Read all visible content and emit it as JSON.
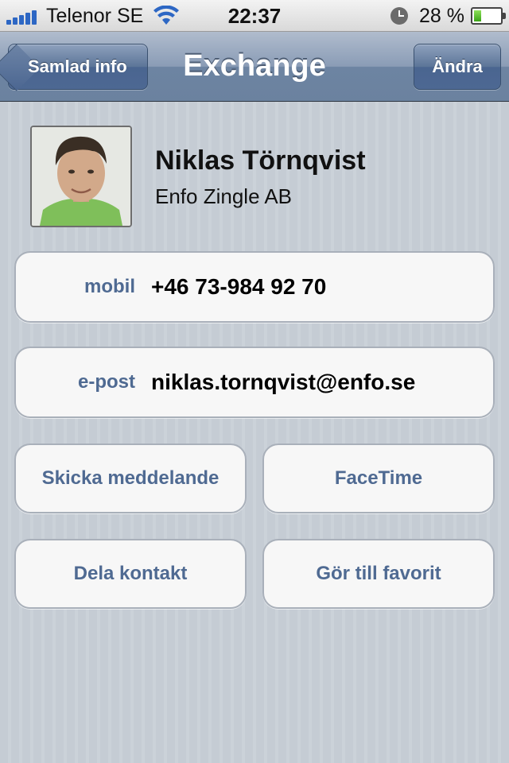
{
  "status_bar": {
    "carrier": "Telenor SE",
    "time": "22:37",
    "battery_percent": "28 %",
    "battery_level": 0.28,
    "signal_bars": 5
  },
  "nav": {
    "back_label": "Samlad info",
    "title": "Exchange",
    "edit_label": "Ändra"
  },
  "contact": {
    "name": "Niklas Törnqvist",
    "company": "Enfo Zingle AB"
  },
  "fields": [
    {
      "label": "mobil",
      "value": "+46 73-984 92 70"
    },
    {
      "label": "e-post",
      "value": "niklas.tornqvist@enfo.se"
    }
  ],
  "actions": {
    "send_message": "Skicka meddelande",
    "facetime": "FaceTime",
    "share_contact": "Dela kontakt",
    "add_favorite": "Gör till favorit"
  },
  "colors": {
    "accent_text": "#4f6a92",
    "navbar": "#6d84a2",
    "background": "#c5ccd4"
  }
}
